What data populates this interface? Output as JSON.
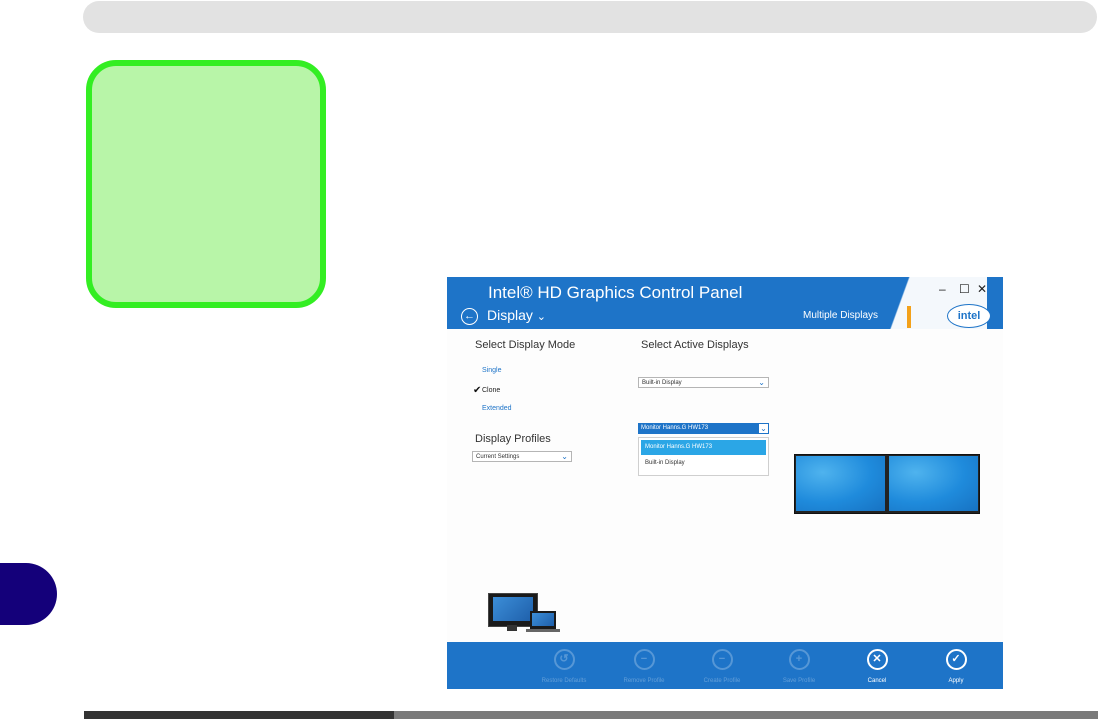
{
  "window": {
    "title": "Intel® HD Graphics Control Panel",
    "controls": {
      "minimize": "–",
      "maximize": "☐",
      "close": "✕"
    },
    "section": "Display",
    "subsection": "Multiple Displays",
    "logo_text": "intel",
    "back_icon": "←",
    "chevron": "⌄"
  },
  "display_mode": {
    "heading": "Select Display Mode",
    "modes": [
      {
        "label": "Single",
        "selected": false
      },
      {
        "label": "Clone",
        "selected": true
      },
      {
        "label": "Extended",
        "selected": false
      }
    ],
    "check": "✔"
  },
  "profiles": {
    "heading": "Display Profiles",
    "selected": "Current Settings"
  },
  "active_displays": {
    "heading": "Select Active Displays",
    "primary": "Built-in Display",
    "secondary": "Monitor Hanns.G HW173",
    "options": [
      "Monitor Hanns.G HW173",
      "Built-in Display"
    ]
  },
  "footer": {
    "buttons": [
      {
        "label": "Restore Defaults",
        "icon": "↺",
        "enabled": false
      },
      {
        "label": "Remove Profile",
        "icon": "−",
        "enabled": false
      },
      {
        "label": "Create Profile",
        "icon": "−",
        "enabled": false
      },
      {
        "label": "Save Profile",
        "icon": "+",
        "enabled": false
      },
      {
        "label": "Cancel",
        "icon": "✕",
        "enabled": true
      },
      {
        "label": "Apply",
        "icon": "✓",
        "enabled": true
      }
    ]
  },
  "colors": {
    "accent": "#1e74c8",
    "highlight": "#2ba6e6",
    "callout_fill": "#b8f5a8",
    "callout_border": "#33ee22",
    "chapter_tab": "#14007a"
  }
}
